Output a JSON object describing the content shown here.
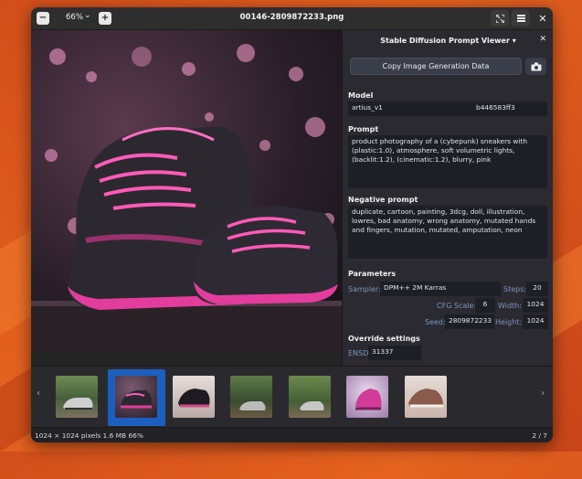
{
  "window": {
    "title": "00146-2809872233.png",
    "zoom": "66%"
  },
  "panel": {
    "title": "Stable Diffusion Prompt Viewer",
    "copy_button": "Copy Image Generation Data",
    "model_label": "Model",
    "model_name": "artius_v1",
    "model_hash": "b446583ff3",
    "prompt_label": "Prompt",
    "prompt": "product photography of a (cybepunk) sneakers with (plastic:1.0), atmosphere, soft volumetric lights, (backlit:1.2), (cinematic:1.2), blurry, pink",
    "negative_label": "Negative prompt",
    "negative_prompt": "duplicate, cartoon, painting, 3dcg, doll, illustration, lowres, bad anatomy, wrong anatomy, mutated hands and fingers, mutation, mutated, amputation, neon",
    "parameters_label": "Parameters",
    "params": {
      "sampler_label": "Sampler:",
      "sampler": "DPM++ 2M Karras",
      "steps_label": "Steps:",
      "steps": "20",
      "cfg_label": "CFG Scale:",
      "cfg": "6",
      "width_label": "Width:",
      "width": "1024",
      "seed_label": "Seed:",
      "seed": "2809872233",
      "height_label": "Height:",
      "height": "1024"
    },
    "override_label": "Override settings",
    "ensd_label": "ENSD:",
    "ensd": "31337"
  },
  "status": {
    "info": "1024 × 1024 pixels  1.6 MB   66%",
    "page": "2 / 7"
  },
  "icons": {
    "zoom_out": "minus-icon",
    "zoom_in": "plus-icon",
    "fullscreen": "expand-icon",
    "menu": "hamburger-icon",
    "close": "close-icon",
    "camera": "camera-icon"
  },
  "colors": {
    "accent": "#1c5fbf",
    "param_label": "#7d95c0",
    "sneaker_pink": "#e23d9c"
  }
}
